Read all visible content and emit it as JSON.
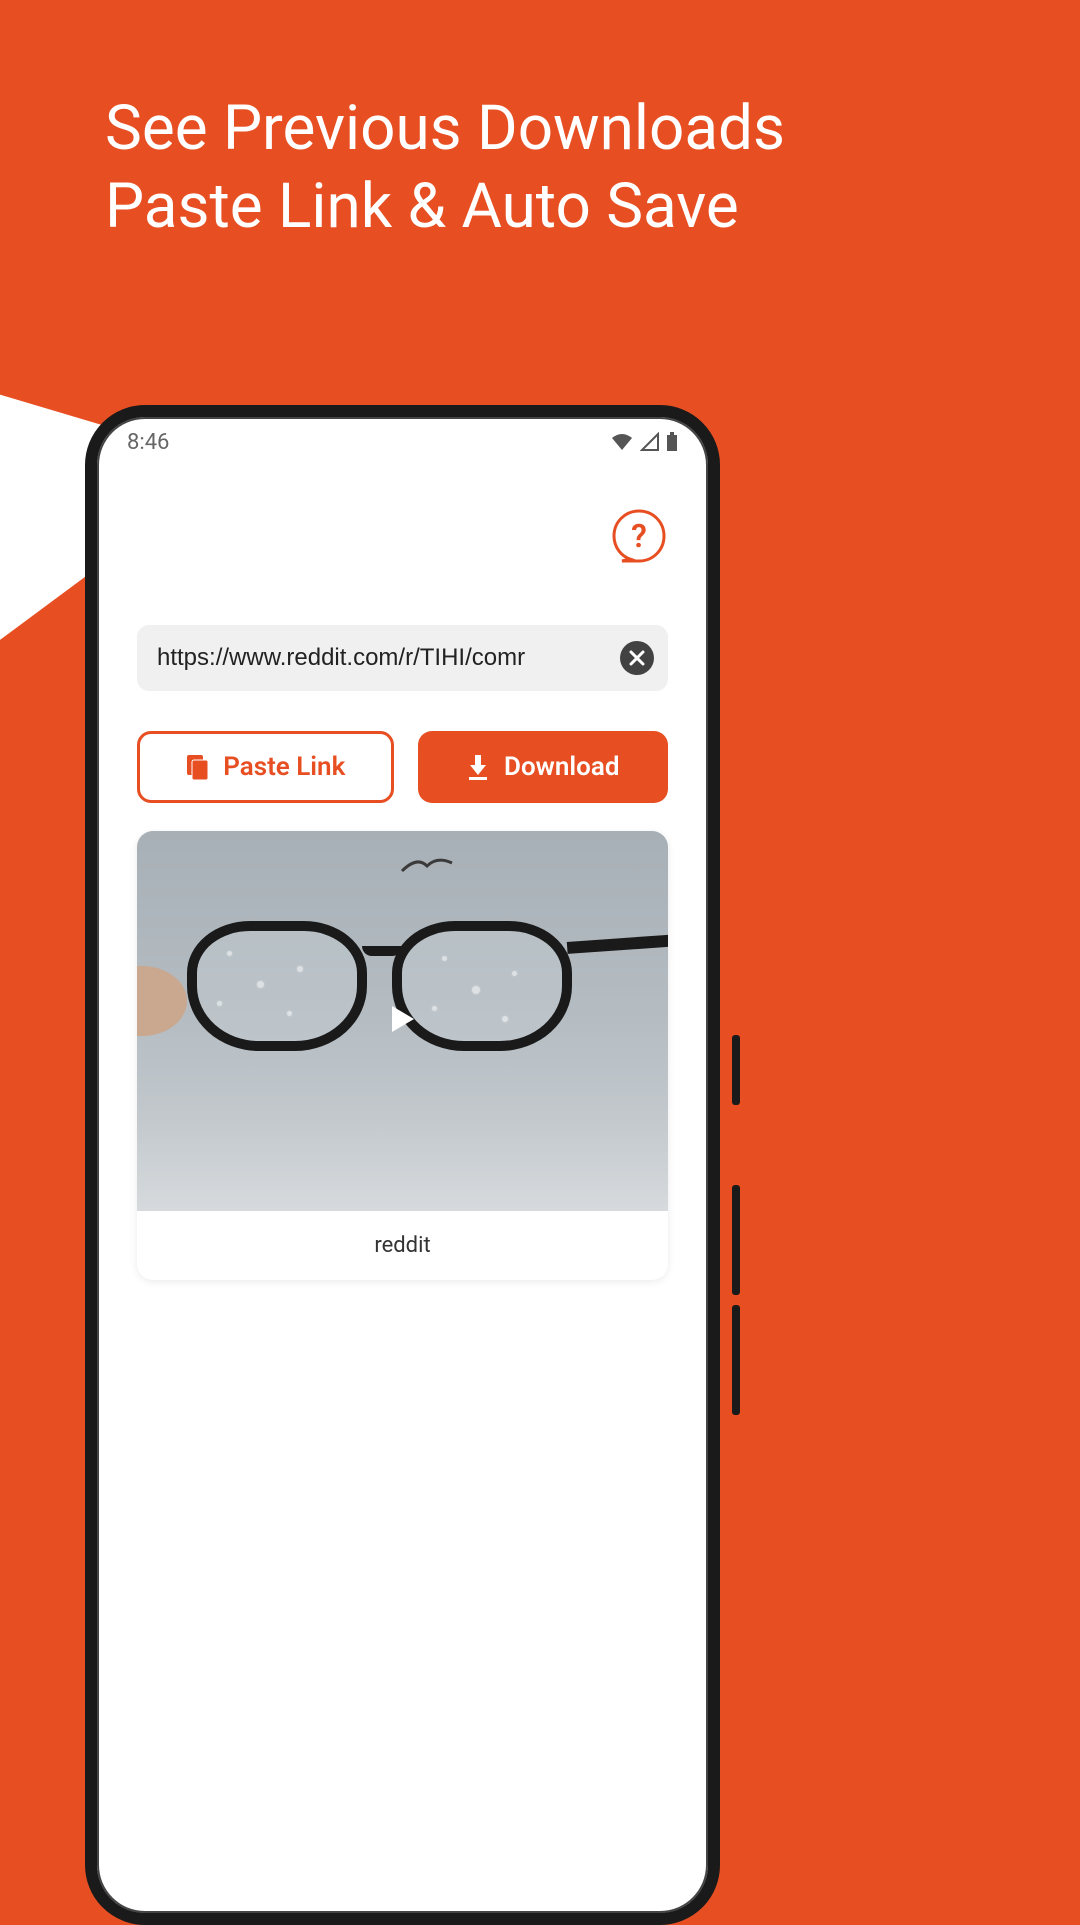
{
  "headline": {
    "line1": "See Previous Downloads",
    "line2": "Paste Link & Auto Save"
  },
  "statusbar": {
    "time": "8:46"
  },
  "url_input": {
    "value": "https://www.reddit.com/r/TIHI/comr"
  },
  "buttons": {
    "paste": "Paste Link",
    "download": "Download"
  },
  "card": {
    "label": "reddit"
  },
  "colors": {
    "accent": "#E74F22"
  }
}
